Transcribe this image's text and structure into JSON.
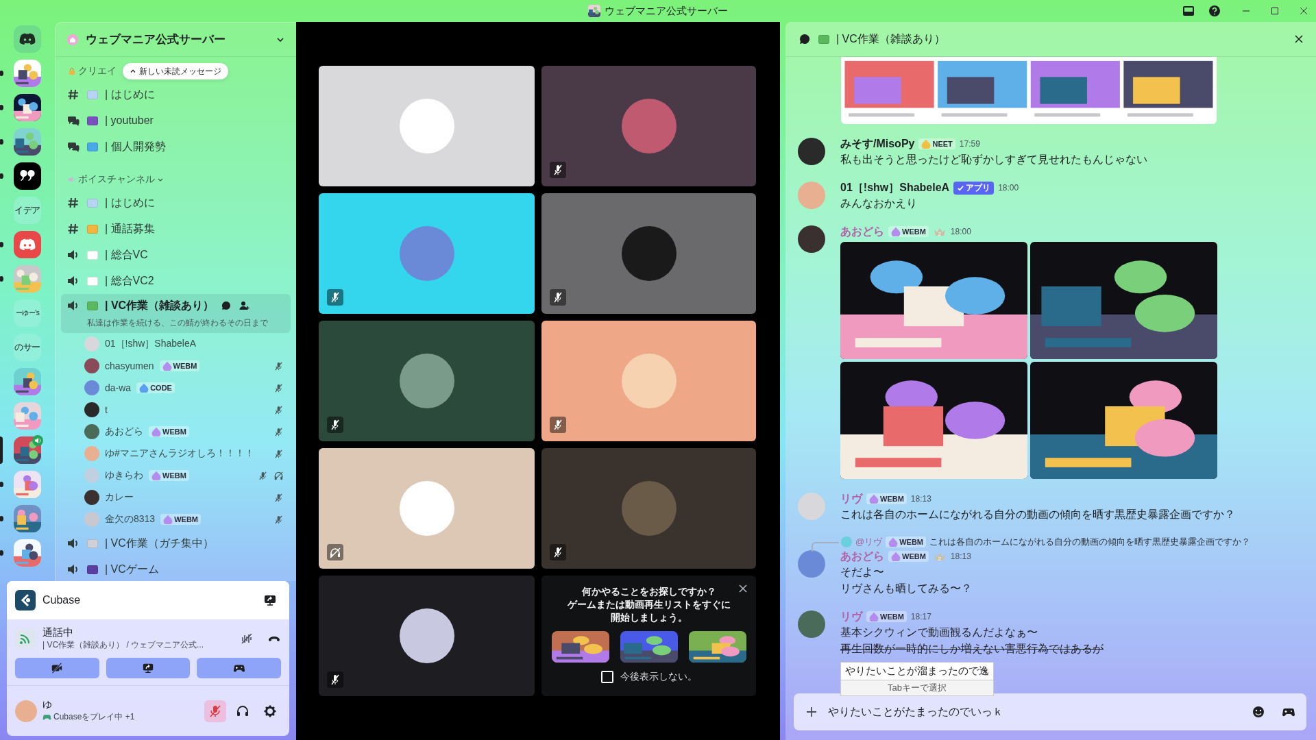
{
  "window": {
    "title": "ウェブマニア公式サーバー"
  },
  "servers": [
    {
      "kind": "logo",
      "color": "#6fdc8c",
      "unread": false,
      "selected": false
    },
    {
      "kind": "picture",
      "color": "#ffffff",
      "unread": true,
      "selected": false
    },
    {
      "kind": "picture",
      "color": "#0b1836",
      "unread": true,
      "selected": false
    },
    {
      "kind": "picture",
      "color": "#7fd4d0",
      "unread": true,
      "selected": false
    },
    {
      "kind": "quote",
      "color": "#000000",
      "unread": true,
      "selected": false
    },
    {
      "kind": "text",
      "label": "イデア",
      "unread": false,
      "selected": false
    },
    {
      "kind": "logo",
      "color": "#e84848",
      "unread": true,
      "selected": false
    },
    {
      "kind": "picture",
      "color": "#c8c8c8",
      "unread": true,
      "selected": false
    },
    {
      "kind": "text",
      "label": "ーゆー's",
      "unread": false,
      "selected": false
    },
    {
      "kind": "text",
      "label": "のサー",
      "unread": false,
      "selected": false
    },
    {
      "kind": "picture",
      "color": "#6fd0d0",
      "unread": false,
      "selected": false
    },
    {
      "kind": "picture",
      "color": "#e6d6dc",
      "unread": false,
      "selected": false
    },
    {
      "kind": "picture",
      "color": "#d04a5a",
      "selected": true,
      "in_voice": true
    },
    {
      "kind": "picture",
      "color": "#ece4f4",
      "unread": true,
      "selected": false
    },
    {
      "kind": "picture",
      "color": "#6f90c4",
      "unread": true,
      "selected": false
    },
    {
      "kind": "picture",
      "color": "#f4f8ff",
      "unread": true,
      "selected": false
    }
  ],
  "server_header": {
    "name": "ウェブマニア公式サーバー"
  },
  "unread_pill": "新しい未読メッセージ",
  "categories": [
    {
      "label": "クリエイ",
      "kind": "lock",
      "channels": [
        {
          "kind": "text",
          "color": "#b8d4f4",
          "name": "| はじめに",
          "selected": false
        },
        {
          "kind": "forum",
          "color": "#7a4fc0",
          "name": "| youtuber",
          "selected": false
        },
        {
          "kind": "forum",
          "color": "#4aa8e8",
          "name": "| 個人開発勢",
          "selected": false
        }
      ]
    },
    {
      "label": "ボイスチャンネル",
      "kind": "speaker",
      "expanded": true,
      "channels": [
        {
          "kind": "text",
          "color": "#b8d4f4",
          "name": "| はじめに",
          "selected": false
        },
        {
          "kind": "text",
          "color": "#f2b640",
          "name": "| 通話募集",
          "selected": false
        },
        {
          "kind": "voice",
          "color": "#ffffff",
          "name": "| 総合VC",
          "selected": false
        },
        {
          "kind": "voice",
          "color": "#ffffff",
          "name": "| 総合VC2",
          "selected": false
        },
        {
          "kind": "voice",
          "color": "#5cb85c",
          "name": "| VC作業（雑談あり）",
          "selected": true,
          "topic": "私達は作業を続ける、この鯖が終わるその日まで",
          "members": [
            {
              "name": "01［!shw］ShabeleA",
              "muted": false,
              "deafened": false
            },
            {
              "name": "chasyumen",
              "tag": {
                "label": "WEBM",
                "color": "#b48cf0"
              },
              "muted": true,
              "deafened": false
            },
            {
              "name": "da-wa",
              "tag": {
                "label": "CODE",
                "color": "#5aa0f0"
              },
              "muted": true,
              "deafened": false
            },
            {
              "name": "t",
              "muted": true,
              "deafened": false
            },
            {
              "name": "あおどら",
              "tag": {
                "label": "WEBM",
                "color": "#b48cf0"
              },
              "muted": true,
              "deafened": false
            },
            {
              "name": "ゆ#マニアさんラジオしろ！！！！",
              "muted": true,
              "deafened": false
            },
            {
              "name": "ゆきらわ",
              "tag": {
                "label": "WEBM",
                "color": "#b48cf0"
              },
              "muted": true,
              "deafened": true
            },
            {
              "name": "カレー",
              "muted": true,
              "deafened": false
            },
            {
              "name": "金欠の8313",
              "tag": {
                "label": "WEBM",
                "color": "#b48cf0"
              },
              "muted": true,
              "deafened": false
            }
          ]
        },
        {
          "kind": "voice",
          "color": "#d0d0d8",
          "name": "| VC作業（ガチ集中）",
          "selected": false
        },
        {
          "kind": "voice",
          "color": "#5a3fa0",
          "name": "| VCゲーム",
          "selected": false
        }
      ]
    }
  ],
  "activity": {
    "name": "Cubase"
  },
  "voice": {
    "status": "通話中",
    "location": "| VC作業（雑談あり） / ウェブマニア公式..."
  },
  "user": {
    "name": "ゆ",
    "status": "Cubaseをプレイ中 +1",
    "mic_muted": true
  },
  "tiles": [
    {
      "color": "#d9d9db",
      "kind": "plain"
    },
    {
      "color": "#4a3a48",
      "kind": "muted"
    },
    {
      "color": "#34d6ee",
      "kind": "muted"
    },
    {
      "color": "#6a6a6c",
      "kind": "muted"
    },
    {
      "color": "#2c4a3c",
      "kind": "muted"
    },
    {
      "color": "#eea888",
      "kind": "muted"
    },
    {
      "color": "#dcc8b4",
      "kind": "deafened"
    },
    {
      "color": "#3a322c",
      "kind": "muted"
    },
    {
      "color": "#1e1e22",
      "kind": "muted"
    }
  ],
  "activity_card": {
    "prompt_lines": [
      "何かやることをお探しですか？",
      "ゲームまたは動画再生リストをすぐに",
      "開始しましょう。"
    ],
    "games": [
      {
        "kind": "picture"
      },
      {
        "kind": "picture"
      },
      {
        "kind": "picture"
      }
    ],
    "dont_show": {
      "label": "今後表示しない。",
      "checked": false
    }
  },
  "chat": {
    "title": "| VC作業（雑談あり）",
    "messages": [
      {
        "kind": "embed"
      },
      {
        "kind": "message",
        "author": "みそす/MisoPy",
        "color": "#1e1f22",
        "badge": {
          "kind": "tag",
          "label": "NEET",
          "color": "#f2c040"
        },
        "time": "17:59",
        "lines": [
          {
            "text": "私も出そうと思ったけど恥ずかしすぎて見せれたもんじゃない",
            "struck": false
          }
        ]
      },
      {
        "kind": "message",
        "author": "01［!shw］ShabeleA",
        "color": "#1e1f22",
        "badge": {
          "kind": "app",
          "label": "アプリ"
        },
        "time": "18:00",
        "lines": [
          {
            "text": "みんなおかえり",
            "struck": false
          }
        ]
      },
      {
        "kind": "message",
        "author": "あおどら",
        "color": "#b060a4",
        "badge": {
          "kind": "tag",
          "label": "WEBM",
          "color": "#b48cf0"
        },
        "boost": "2",
        "time": "18:00",
        "attachments": [
          {
            "kind": "picture"
          },
          {
            "kind": "picture"
          },
          {
            "kind": "picture"
          },
          {
            "kind": "picture"
          }
        ]
      },
      {
        "kind": "message",
        "author": "リヴ",
        "color": "#b060a4",
        "badge": {
          "kind": "tag",
          "label": "WEBM",
          "color": "#b48cf0"
        },
        "time": "18:13",
        "lines": [
          {
            "text": "これは各自のホームにながれる自分の動画の傾向を晒す黒歴史暴露企画ですか？",
            "struck": false
          }
        ]
      },
      {
        "kind": "message",
        "reply": {
          "author": "@リヴ",
          "badge": {
            "kind": "tag",
            "label": "WEBM",
            "color": "#b48cf0"
          },
          "text": "これは各自のホームにながれる自分の動画の傾向を晒す黒歴史暴露企画ですか？"
        },
        "author": "あおどら",
        "color": "#b060a4",
        "badge": {
          "kind": "tag",
          "label": "WEBM",
          "color": "#b48cf0"
        },
        "boost": "2",
        "time": "18:13",
        "lines": [
          {
            "text": "そだよ〜",
            "struck": false
          },
          {
            "text": "リヴさんも晒してみる〜？",
            "struck": false
          }
        ]
      },
      {
        "kind": "message",
        "author": "リヴ",
        "color": "#b060a4",
        "badge": {
          "kind": "tag",
          "label": "WEBM",
          "color": "#b48cf0"
        },
        "time": "18:17",
        "lines": [
          {
            "text": "基本シクウィンで動画観るんだよなぁ〜",
            "struck": false
          },
          {
            "text": "再生回数が一時的にしか増えない害悪行為ではあるが",
            "struck": true
          }
        ]
      }
    ],
    "input": {
      "value": "やりたいことがたまったのでいっｋ"
    },
    "ime": {
      "candidate": "やりたいことが溜まったので逸",
      "hint": "Tabキーで選択"
    }
  }
}
